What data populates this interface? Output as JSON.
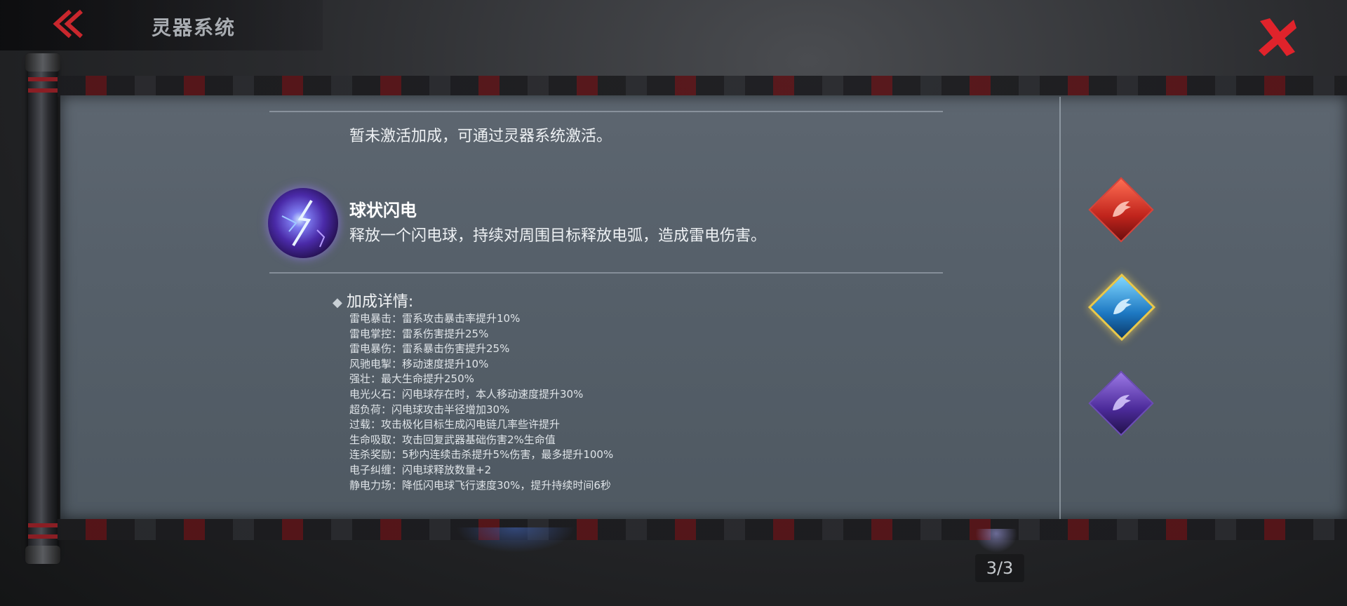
{
  "header": {
    "title": "灵器系统",
    "back_icon": "double-chevron-left-icon",
    "close_icon": "close-x-icon",
    "accent_color": "#e0232b"
  },
  "panel": {
    "status_text": "暂未激活加成，可通过灵器系统激活。",
    "skill": {
      "icon": "lightning-orb-icon",
      "name": "球状闪电",
      "description": "释放一个闪电球，持续对周围目标释放电弧，造成雷电伤害。"
    },
    "bonus": {
      "title": "加成详情:",
      "items": [
        "雷电暴击：雷系攻击暴击率提升10%",
        "雷电掌控：雷系伤害提升25%",
        "雷电暴伤：雷系暴击伤害提升25%",
        "风驰电掣：移动速度提升10%",
        "强壮：最大生命提升250%",
        "电光火石：闪电球存在时，本人移动速度提升30%",
        "超负荷：闪电球攻击半径增加30%",
        "过载：攻击极化目标生成闪电链几率些许提升",
        "生命吸取：攻击回复武器基础伤害2%生命值",
        "连杀奖励：5秒内连续击杀提升5%伤害，最多提升100%",
        "电子纠缠：闪电球释放数量+2",
        "静电力场：降低闪电球飞行速度30%，提升持续时间6秒"
      ]
    }
  },
  "emblems": [
    {
      "name": "red-dragon-emblem",
      "color": "#d9433a",
      "icon": "dragon-head-icon",
      "selected": false
    },
    {
      "name": "blue-dragon-emblem",
      "color": "#2a8fd6",
      "icon": "dragon-head-icon",
      "selected": true
    },
    {
      "name": "purple-dragon-emblem",
      "color": "#6c4bb8",
      "icon": "dragon-head-icon",
      "selected": false
    }
  ],
  "pagination": {
    "text": "3/3"
  }
}
